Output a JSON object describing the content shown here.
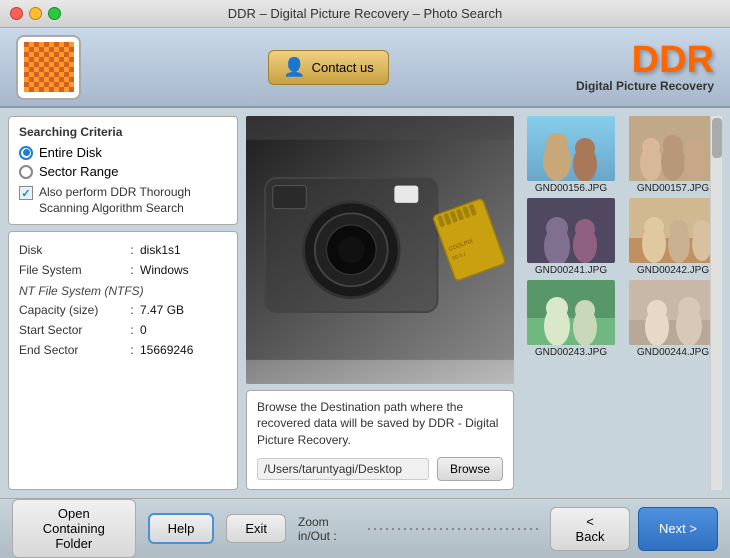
{
  "window": {
    "title": "DDR – Digital Picture Recovery – Photo Search"
  },
  "header": {
    "contact_button": "Contact us",
    "ddr_logo": "DDR",
    "ddr_subtitle": "Digital Picture Recovery"
  },
  "search_criteria": {
    "title": "Searching Criteria",
    "radio_entire_disk": "Entire Disk",
    "radio_sector_range": "Sector Range",
    "checkbox_label": "Also perform DDR Thorough Scanning Algorithm Search"
  },
  "disk_info": {
    "disk_label": "Disk",
    "disk_colon": ":",
    "disk_value": "disk1s1",
    "fs_label": "File System",
    "fs_colon": ":",
    "fs_value": "Windows",
    "ntfs_label": "NT File System (NTFS)",
    "capacity_label": "Capacity (size)",
    "capacity_colon": ":",
    "capacity_value": "7.47 GB",
    "start_label": "Start Sector",
    "start_colon": ":",
    "start_value": "0",
    "end_label": "End Sector",
    "end_colon": ":",
    "end_value": "15669246"
  },
  "destination": {
    "text": "Browse the Destination path where the recovered data will be saved by DDR - Digital Picture Recovery.",
    "path": "/Users/taruntyagi/Desktop",
    "browse_btn": "Browse"
  },
  "thumbnails": [
    {
      "label": "GND00156.JPG"
    },
    {
      "label": "GND00157.JPG"
    },
    {
      "label": "GND00241.JPG"
    },
    {
      "label": "GND00242.JPG"
    },
    {
      "label": "GND00243.JPG"
    },
    {
      "label": "GND00244.JPG"
    }
  ],
  "footer": {
    "open_folder_btn": "Open Containing Folder",
    "help_btn": "Help",
    "exit_btn": "Exit",
    "zoom_label": "Zoom in/Out :",
    "back_btn": "< Back",
    "next_btn": "Next >"
  }
}
